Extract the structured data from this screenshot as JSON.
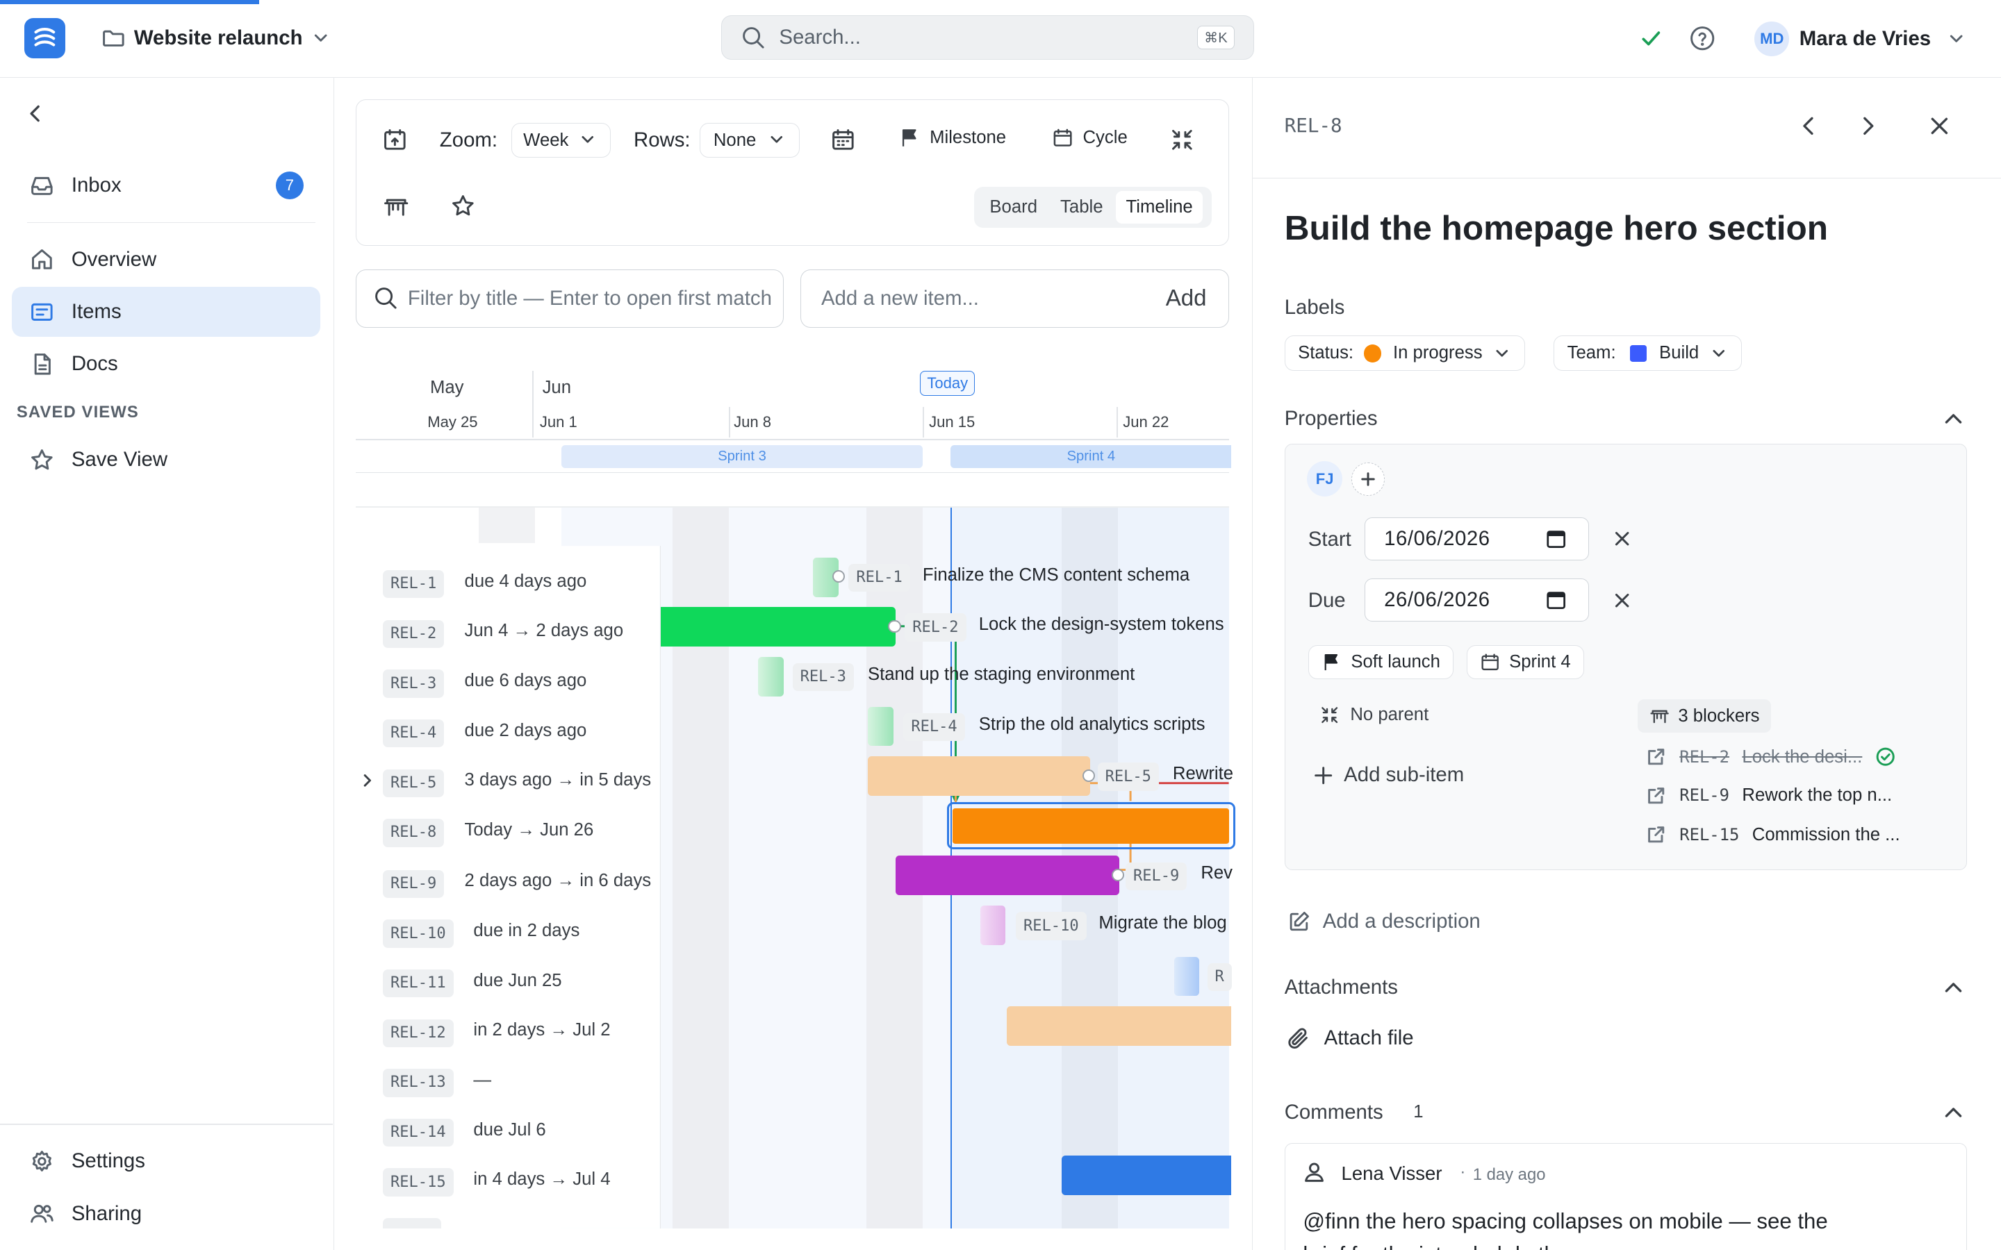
{
  "app": {
    "project_name": "Website relaunch"
  },
  "search": {
    "placeholder": "Search...",
    "shortcut": "⌘K"
  },
  "user": {
    "initials": "MD",
    "name": "Mara de Vries"
  },
  "sidebar": {
    "inbox_label": "Inbox",
    "inbox_count": "7",
    "items": [
      {
        "label": "Overview"
      },
      {
        "label": "Items"
      },
      {
        "label": "Docs"
      }
    ],
    "saved_views_heading": "SAVED VIEWS",
    "save_view_label": "Save View",
    "settings_label": "Settings",
    "sharing_label": "Sharing"
  },
  "toolbar": {
    "zoom_label": "Zoom:",
    "zoom_value": "Week",
    "rows_label": "Rows:",
    "rows_value": "None",
    "milestone_label": "Milestone",
    "cycle_label": "Cycle",
    "views": [
      "Board",
      "Table",
      "Timeline"
    ],
    "active_view": "Timeline"
  },
  "filter": {
    "placeholder": "Filter by title — Enter to open first match"
  },
  "add_item": {
    "placeholder": "Add a new item...",
    "button": "Add"
  },
  "timeline": {
    "months": [
      "May",
      "Jun"
    ],
    "weeks": [
      "May 25",
      "Jun 1",
      "Jun 8",
      "Jun 15",
      "Jun 22"
    ],
    "today_label": "Today",
    "sprints": [
      "Sprint 3",
      "Sprint 4"
    ],
    "rows": [
      {
        "id": "REL-1",
        "when": "due 4 days ago"
      },
      {
        "id": "REL-2",
        "when": "Jun 4 → 2 days ago"
      },
      {
        "id": "REL-3",
        "when": "due 6 days ago"
      },
      {
        "id": "REL-4",
        "when": "due 2 days ago"
      },
      {
        "id": "REL-5",
        "when": "3 days ago → in 5 days"
      },
      {
        "id": "REL-8",
        "when": "Today → Jun 26"
      },
      {
        "id": "REL-9",
        "when": "2 days ago → in 6 days"
      },
      {
        "id": "REL-10",
        "when": "due in 2 days"
      },
      {
        "id": "REL-11",
        "when": "due Jun 25"
      },
      {
        "id": "REL-12",
        "when": "in 2 days → Jul 2"
      },
      {
        "id": "REL-13",
        "when": "—"
      },
      {
        "id": "REL-14",
        "when": "due Jul 6"
      },
      {
        "id": "REL-15",
        "when": "in 4 days → Jul 4"
      }
    ],
    "bars": [
      {
        "id": "REL-1",
        "title": "Finalize the CMS content schema",
        "color": "#9be3b7"
      },
      {
        "id": "REL-2",
        "title": "Lock the design-system tokens",
        "color": "#0fd85a"
      },
      {
        "id": "REL-3",
        "title": "Stand up the staging environment",
        "color": "#9be3b7"
      },
      {
        "id": "REL-4",
        "title": "Strip the old analytics scripts",
        "color": "#9be3b7"
      },
      {
        "id": "REL-5",
        "title": "Rewrite",
        "color": "#f7cfa2"
      },
      {
        "id": "REL-8",
        "title": "",
        "color": "#f98a06"
      },
      {
        "id": "REL-9",
        "title": "Rev",
        "color": "#b52fc9"
      },
      {
        "id": "REL-10",
        "title": "Migrate the blog",
        "color": "#e3b4ea"
      },
      {
        "id": "REL-11",
        "title": "",
        "color": "#a9c9f7"
      },
      {
        "id": "REL-12",
        "title": "",
        "color": "#f7cfa2"
      },
      {
        "id": "REL-15",
        "title": "",
        "color": "#2f7ae5"
      }
    ],
    "partial_label": "R"
  },
  "detail": {
    "id": "REL-8",
    "title": "Build the homepage hero section",
    "labels_heading": "Labels",
    "status_label": "Status:",
    "status_value": "In progress",
    "status_color": "#f98a06",
    "team_label": "Team:",
    "team_value": "Build",
    "team_color": "#3b5bfd",
    "properties_heading": "Properties",
    "assignee_initials": "FJ",
    "start_label": "Start",
    "start_value": "16/06/2026",
    "due_label": "Due",
    "due_value": "26/06/2026",
    "milestone": "Soft launch",
    "cycle": "Sprint 4",
    "parent": "No parent",
    "blockers": "3 blockers",
    "add_sub_item": "Add sub-item",
    "blocker_items": [
      {
        "id": "REL-2",
        "title": "Lock the desi...",
        "done": true
      },
      {
        "id": "REL-9",
        "title": "Rework the top n...",
        "done": false
      },
      {
        "id": "REL-15",
        "title": "Commission the ...",
        "done": false
      }
    ],
    "add_description": "Add a description",
    "attachments_heading": "Attachments",
    "attach_file": "Attach file",
    "comments_heading": "Comments",
    "comments_count": "1",
    "comment": {
      "author": "Lena Visser",
      "time": "1 day ago",
      "text": "@finn the hero spacing collapses on mobile — see the",
      "text2": "brief for the intended rhythm."
    }
  }
}
